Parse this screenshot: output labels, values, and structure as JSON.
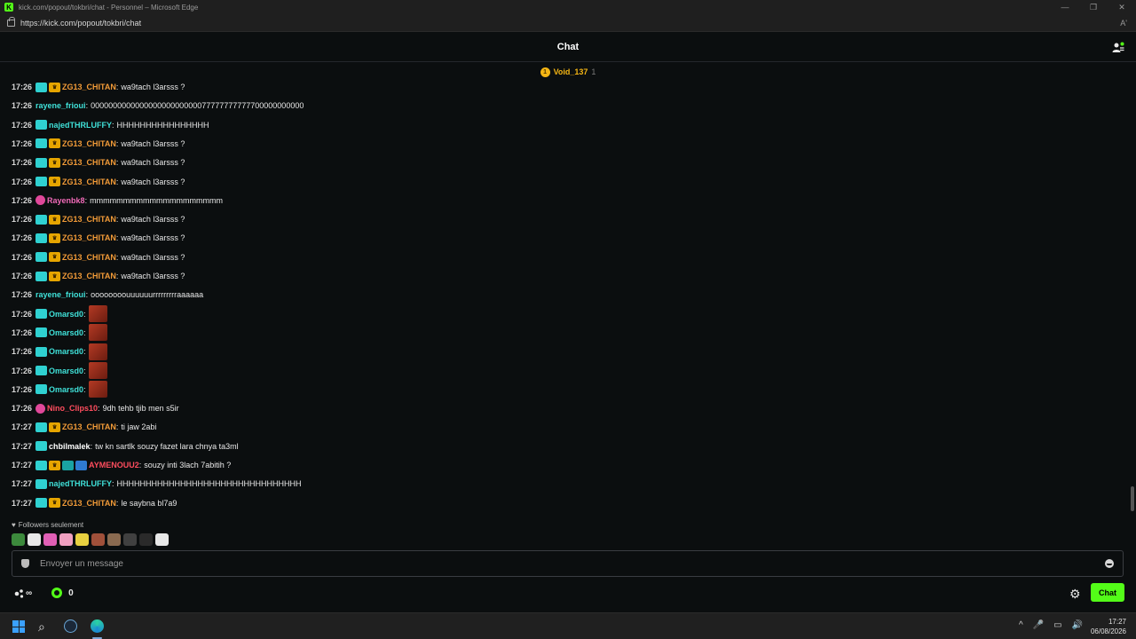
{
  "window": {
    "title": "kick.com/popout/tokbri/chat - Personnel – Microsoft Edge",
    "url": "https://kick.com/popout/tokbri/chat",
    "reader_icon": "Aʹ",
    "controls": [
      "—",
      "❐",
      "✕"
    ]
  },
  "header": {
    "title": "Chat"
  },
  "pinned": {
    "name": "Void_137",
    "count": "1"
  },
  "colors": {
    "orange": "#f29b38",
    "cyan": "#3fe0d8",
    "pink": "#f06ab8",
    "red": "#ff4d5e",
    "white": "#ffffff",
    "accent": "#53fc18"
  },
  "messages": [
    {
      "time": "17:26",
      "badges": [
        "sub",
        "crown"
      ],
      "user": "ZG13_CHITAN",
      "color": "#f29b38",
      "text": "wa9tach l3arsss ?"
    },
    {
      "time": "17:26",
      "badges": [],
      "user": "rayene_frioui",
      "color": "#3fe0d8",
      "text": "000000000000000000000000077777777777700000000000"
    },
    {
      "time": "17:26",
      "badges": [
        "sub"
      ],
      "user": "najedTHRLUFFY",
      "color": "#3fe0d8",
      "text": "HHHHHHHHHHHHHHHH"
    },
    {
      "time": "17:26",
      "badges": [
        "sub",
        "crown"
      ],
      "user": "ZG13_CHITAN",
      "color": "#f29b38",
      "text": "wa9tach l3arsss ?"
    },
    {
      "time": "17:26",
      "badges": [
        "sub",
        "crown"
      ],
      "user": "ZG13_CHITAN",
      "color": "#f29b38",
      "text": "wa9tach l3arsss ?"
    },
    {
      "time": "17:26",
      "badges": [
        "sub",
        "crown"
      ],
      "user": "ZG13_CHITAN",
      "color": "#f29b38",
      "text": "wa9tach l3arsss ?"
    },
    {
      "time": "17:26",
      "badges": [
        "pink"
      ],
      "user": "Rayenbk8",
      "color": "#f06ab8",
      "text": "mmmmmmmmmmmmmmmmmmmm"
    },
    {
      "time": "17:26",
      "badges": [
        "sub",
        "crown"
      ],
      "user": "ZG13_CHITAN",
      "color": "#f29b38",
      "text": "wa9tach l3arsss ?"
    },
    {
      "time": "17:26",
      "badges": [
        "sub",
        "crown"
      ],
      "user": "ZG13_CHITAN",
      "color": "#f29b38",
      "text": "wa9tach l3arsss ?"
    },
    {
      "time": "17:26",
      "badges": [
        "sub",
        "crown"
      ],
      "user": "ZG13_CHITAN",
      "color": "#f29b38",
      "text": "wa9tach l3arsss ?"
    },
    {
      "time": "17:26",
      "badges": [
        "sub",
        "crown"
      ],
      "user": "ZG13_CHITAN",
      "color": "#f29b38",
      "text": "wa9tach l3arsss ?"
    },
    {
      "time": "17:26",
      "badges": [],
      "user": "rayene_frioui",
      "color": "#3fe0d8",
      "text": "oooooooouuuuuurrrrrrrrraaaaaa"
    },
    {
      "time": "17:26",
      "badges": [
        "sub"
      ],
      "user": "Omarsd0",
      "color": "#3fe0d8",
      "text": "",
      "emote": "red-face-emote"
    },
    {
      "time": "17:26",
      "badges": [
        "sub"
      ],
      "user": "Omarsd0",
      "color": "#3fe0d8",
      "text": "",
      "emote": "red-face-emote"
    },
    {
      "time": "17:26",
      "badges": [
        "sub"
      ],
      "user": "Omarsd0",
      "color": "#3fe0d8",
      "text": "",
      "emote": "red-face-emote"
    },
    {
      "time": "17:26",
      "badges": [
        "sub"
      ],
      "user": "Omarsd0",
      "color": "#3fe0d8",
      "text": "",
      "emote": "red-face-emote"
    },
    {
      "time": "17:26",
      "badges": [
        "sub"
      ],
      "user": "Omarsd0",
      "color": "#3fe0d8",
      "text": "",
      "emote": "red-face-emote"
    },
    {
      "time": "17:26",
      "badges": [
        "pink"
      ],
      "user": "Nino_Clips10",
      "color": "#ff4d5e",
      "text": "9dh tehb tjib men s5ir"
    },
    {
      "time": "17:27",
      "badges": [
        "sub",
        "crown"
      ],
      "user": "ZG13_CHITAN",
      "color": "#f29b38",
      "text": "ti jaw 2abi"
    },
    {
      "time": "17:27",
      "badges": [
        "sub"
      ],
      "user": "chbilmalek",
      "color": "#ffffff",
      "text": "tw kn sartlk souzy fazet lara chnya ta3ml"
    },
    {
      "time": "17:27",
      "badges": [
        "sub",
        "crown",
        "teal2",
        "blue"
      ],
      "user": "AYMENOUU2",
      "color": "#ff4d5e",
      "text": "souzy inti 3lach 7abitih ?"
    },
    {
      "time": "17:27",
      "badges": [
        "sub"
      ],
      "user": "najedTHRLUFFY",
      "color": "#3fe0d8",
      "text": "HHHHHHHHHHHHHHHHHHHHHHHHHHHHHHHH"
    },
    {
      "time": "17:27",
      "badges": [
        "sub",
        "crown"
      ],
      "user": "ZG13_CHITAN",
      "color": "#f29b38",
      "text": "le saybna bl7a9"
    }
  ],
  "followers_only": {
    "label": "Followers seulement"
  },
  "emote_bar": [
    {
      "name": "pepe-emote",
      "color": "#3c8a3c"
    },
    {
      "name": "kick-k-emote",
      "color": "#e8e8e8"
    },
    {
      "name": "pink-pill-emote",
      "color": "#e05fb5"
    },
    {
      "name": "pink-blob-emote",
      "color": "#f0a0c0"
    },
    {
      "name": "yellow-bird-emote",
      "color": "#e8d040"
    },
    {
      "name": "face-emote",
      "color": "#a0503a"
    },
    {
      "name": "meme-emote",
      "color": "#8a6a50"
    },
    {
      "name": "dark-cat-emote",
      "color": "#404040"
    },
    {
      "name": "hat-emote",
      "color": "#2a2a2a"
    },
    {
      "name": "mute-emote",
      "color": "#e8e8e8"
    }
  ],
  "input": {
    "placeholder": "Envoyer un message"
  },
  "toolbar": {
    "infinity": "∞",
    "points": "0",
    "chat_label": "Chat"
  },
  "taskbar": {
    "time": "17:27",
    "date": "06/08/2026",
    "tray": [
      "^",
      "🎤",
      "▭",
      "🔊"
    ]
  }
}
